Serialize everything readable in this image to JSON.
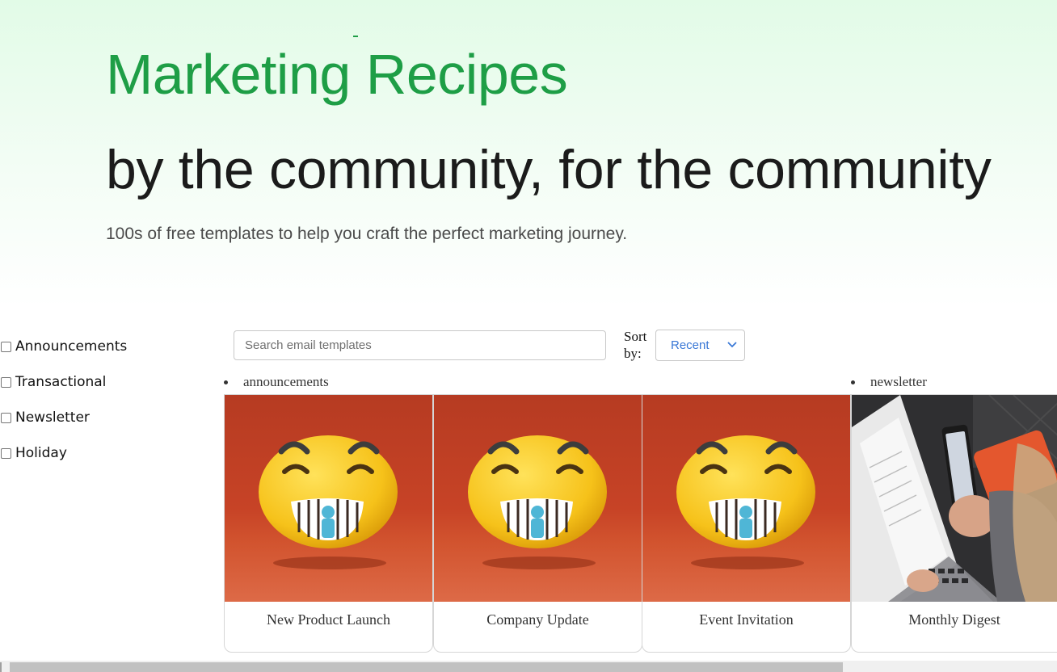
{
  "hero": {
    "title": "Marketing Recipes",
    "subtitle": "by the community, for the community",
    "description": "100s of free templates to help you craft the perfect marketing journey."
  },
  "filters": [
    {
      "label": "Announcements",
      "checked": false
    },
    {
      "label": "Transactional",
      "checked": false
    },
    {
      "label": "Newsletter",
      "checked": false
    },
    {
      "label": "Holiday",
      "checked": false
    }
  ],
  "search": {
    "placeholder": "Search email templates",
    "value": ""
  },
  "sort": {
    "label": "Sort by:",
    "selected": "Recent"
  },
  "tags": {
    "announcements": "announcements",
    "newsletter": "newsletter"
  },
  "cards": [
    {
      "title": "New Product Launch",
      "image": "smiley-emoji-image"
    },
    {
      "title": "Company Update",
      "image": "smiley-emoji-image"
    },
    {
      "title": "Event Invitation",
      "image": "smiley-emoji-image"
    },
    {
      "title": "Monthly Digest",
      "image": "laptop-phone-photo"
    }
  ],
  "colors": {
    "brand_green": "#1e9e46",
    "link_blue": "#3a78d6",
    "card_orange": "#c44124"
  },
  "icons": {
    "sort_chevron": "chevron-down-icon",
    "filter_checkbox": "checkbox-icon"
  }
}
